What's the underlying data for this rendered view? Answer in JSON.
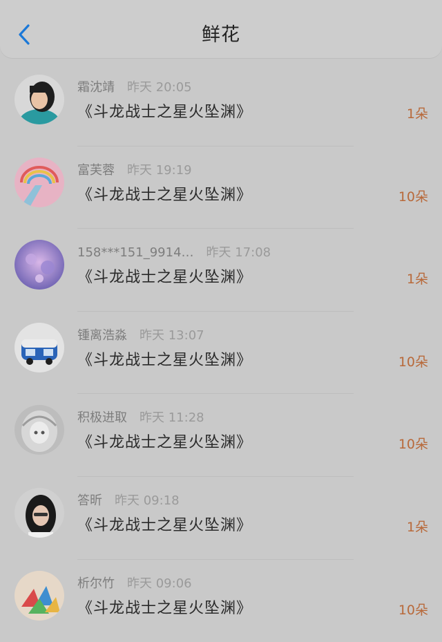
{
  "header": {
    "title": "鲜花",
    "back": "back"
  },
  "items": [
    {
      "name": "霜沈靖",
      "time": "昨天 20:05",
      "work": "《斗龙战士之星火坠渊》",
      "count": "1朵",
      "avatar": "child-photo"
    },
    {
      "name": "富芙蓉",
      "time": "昨天 19:19",
      "work": "《斗龙战士之星火坠渊》",
      "count": "10朵",
      "avatar": "rainbow-illustration"
    },
    {
      "name": "158***151_9914…",
      "time": "昨天 17:08",
      "work": "《斗龙战士之星火坠渊》",
      "count": "1朵",
      "avatar": "purple-dream"
    },
    {
      "name": "锺离浩淼",
      "time": "昨天 13:07",
      "work": "《斗龙战士之星火坠渊》",
      "count": "10朵",
      "avatar": "blue-van"
    },
    {
      "name": "积极进取",
      "time": "昨天 11:28",
      "work": "《斗龙战士之星火坠渊》",
      "count": "10朵",
      "avatar": "anime-girl"
    },
    {
      "name": "答昕",
      "time": "昨天 09:18",
      "work": "《斗龙战士之星火坠渊》",
      "count": "1朵",
      "avatar": "woman-portrait"
    },
    {
      "name": "析尔竹",
      "time": "昨天 09:06",
      "work": "《斗龙战士之星火坠渊》",
      "count": "10朵",
      "avatar": "paper-cranes"
    }
  ],
  "colors": {
    "accent": "#1a78d8",
    "count": "#b8693a",
    "background": "#c9c9c9"
  }
}
